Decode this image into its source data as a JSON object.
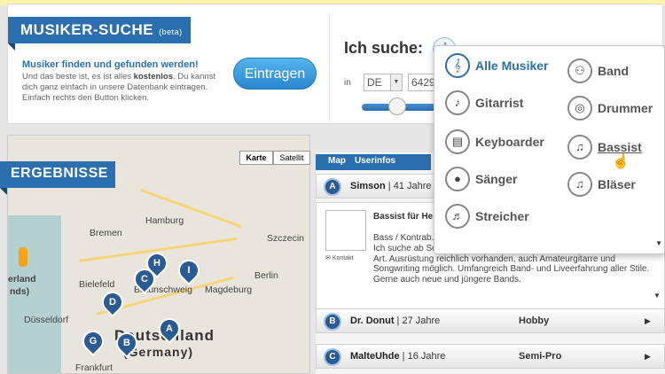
{
  "header": {
    "title": "MUSIKER-SUCHE",
    "beta": "(beta)",
    "intro_title": "Musiker finden und gefunden werden!",
    "intro_text_1": "Und das beste ist, es ist alles ",
    "intro_text_bold": "kostenlos",
    "intro_text_2": ". Du kannst dich ganz einfach in unsere Datenbank eintragen. Einfach rechts den Button klicken.",
    "register_button": "Eintragen"
  },
  "search": {
    "label": "Ich suche:",
    "in_label": "in",
    "country": "DE",
    "postal_code": "64293",
    "icon": "guitar-clef-icon"
  },
  "categories": [
    {
      "label": "Alle Musiker",
      "icon": "clef-icon",
      "state": "active"
    },
    {
      "label": "Band",
      "icon": "band-icon",
      "state": ""
    },
    {
      "label": "Gitarrist",
      "icon": "guitar-icon",
      "state": ""
    },
    {
      "label": "Drummer",
      "icon": "drum-icon",
      "state": ""
    },
    {
      "label": "Keyboarder",
      "icon": "keyboard-icon",
      "state": ""
    },
    {
      "label": "Bassist",
      "icon": "bass-icon",
      "state": "hover"
    },
    {
      "label": "Sänger",
      "icon": "microphone-icon",
      "state": ""
    },
    {
      "label": "Bläser",
      "icon": "saxophone-icon",
      "state": ""
    },
    {
      "label": "Streicher",
      "icon": "violin-icon",
      "state": ""
    }
  ],
  "map": {
    "section_title": "ERGEBNISSE",
    "type_map": "Karte",
    "type_satellite": "Satellit",
    "country_label": "Deutschland",
    "country_sub": "(Germany)",
    "cities": [
      "Hamburg",
      "Bremen",
      "Szczecin",
      "Bielefeld",
      "Braunschweig",
      "Magdeburg",
      "Berlin",
      "Düsseldorf",
      "Frankfurt",
      "erland",
      "nds)"
    ],
    "pins": [
      "A",
      "B",
      "C",
      "D",
      "G",
      "H",
      "I"
    ]
  },
  "results": {
    "tab_map": "Map",
    "tab_info": "Userinfos",
    "rows": [
      {
        "badge": "A",
        "name": "Simson",
        "age": "41 Jahre",
        "level": "",
        "expanded": true
      },
      {
        "badge": "B",
        "name": "Dr. Donut",
        "age": "27 Jahre",
        "level": "Hobby"
      },
      {
        "badge": "C",
        "name": "MalteUhde",
        "age": "16 Jahre",
        "level": "Semi-Pro"
      }
    ],
    "detail": {
      "title": "Bassist für He... Rock und And...",
      "sub": "Bass / Kontrab...",
      "text": "Ich suche ab Sommer 2013 in Erfurt eine Band für Gitarrenmusik aller Art. Ausrüstung reichlich vorhanden, auch Amateurgitarre und Songwriting möglich. Umfangreich Band- und Liveerfahrung aller Stile. Gerne auch neue und jüngere Bands.",
      "contact": "Kontakt"
    }
  },
  "colors": {
    "brand_blue": "#2c6fb0",
    "pin_blue": "#2c5b94",
    "banner_yellow": "#fff3a8"
  }
}
